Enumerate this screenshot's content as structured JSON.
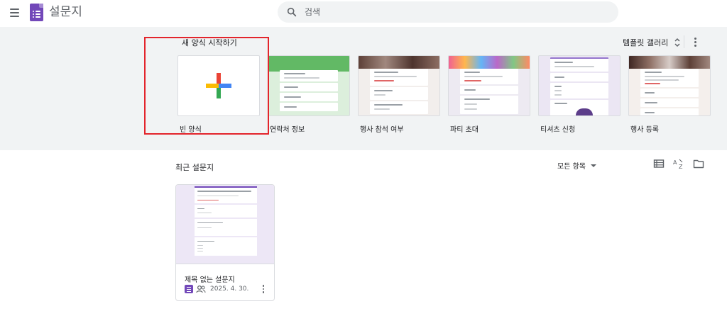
{
  "header": {
    "app_title": "설문지",
    "search_placeholder": "검색",
    "menu_icon": "hamburger-menu-icon",
    "logo_icon": "forms-logo-icon"
  },
  "gallery": {
    "heading": "새 양식 시작하기",
    "gallery_link": "템플릿 갤러리",
    "templates": [
      {
        "label": "빈 양식",
        "accent": "#ffffff"
      },
      {
        "label": "연락처 정보",
        "accent": "#4caf50"
      },
      {
        "label": "행사 참석 여부",
        "accent": "#8d6e63"
      },
      {
        "label": "파티 초대",
        "accent": "#e91e63"
      },
      {
        "label": "티셔츠 신청",
        "accent": "#9575cd"
      },
      {
        "label": "행사 등록",
        "accent": "#795548"
      }
    ]
  },
  "recent": {
    "heading": "최근 설문지",
    "owner_filter": "모든 항목",
    "docs": [
      {
        "title": "제목 없는 설문지",
        "date": "2025. 4. 30."
      }
    ]
  },
  "colors": {
    "brand": "#7248b9",
    "highlight": "#e3242b",
    "gallery_bg": "#f1f3f4"
  }
}
